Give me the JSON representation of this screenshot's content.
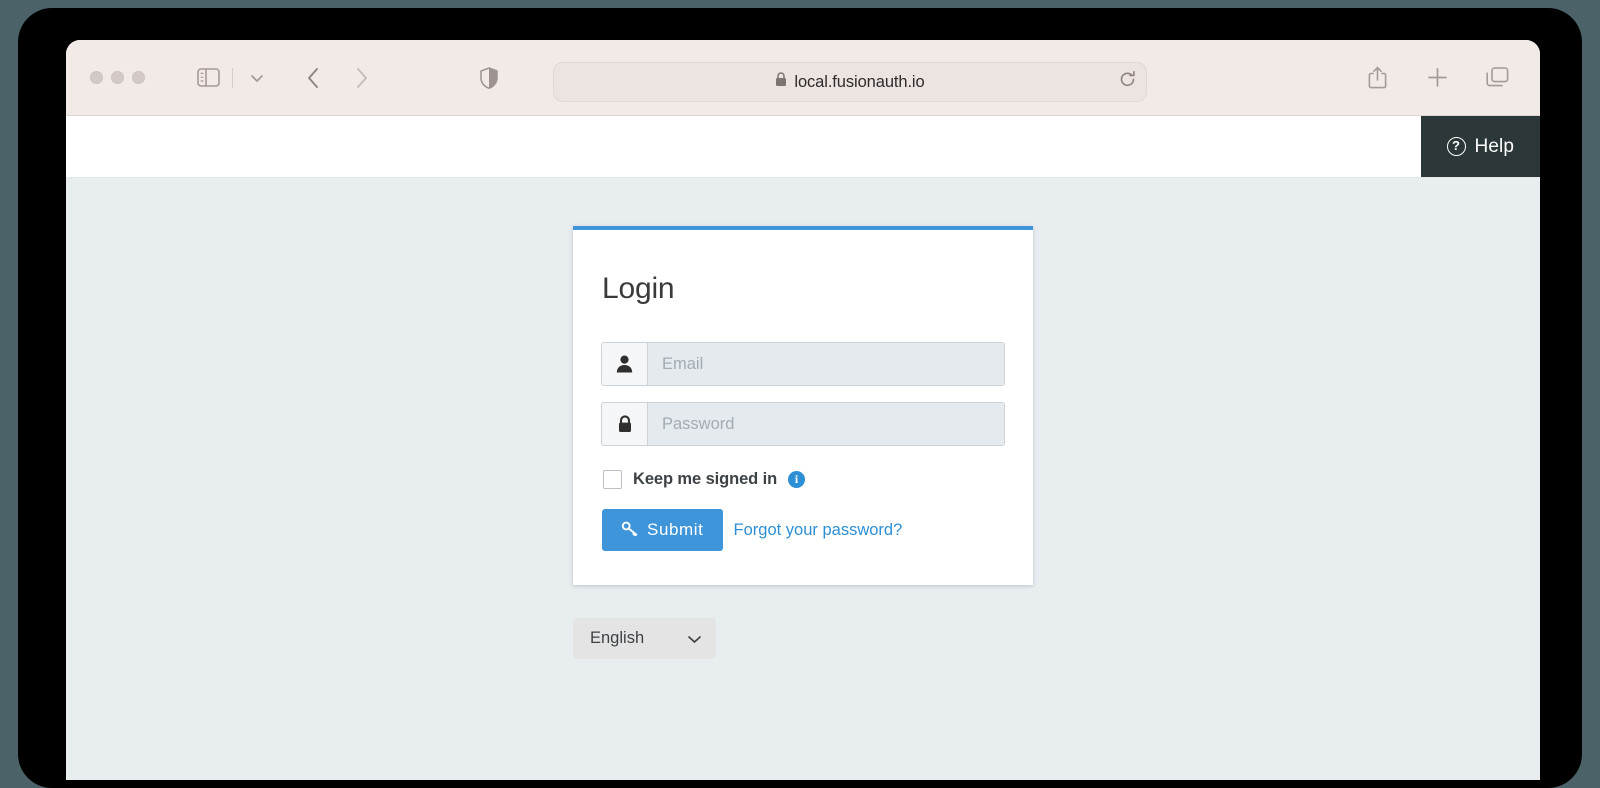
{
  "browser": {
    "traffic_lights": [
      "close",
      "minimize",
      "zoom"
    ],
    "sidebar_toggle_icon": "sidebar-icon",
    "sidebar_dropdown_icon": "chevron-down-icon",
    "back_icon": "chevron-left-icon",
    "forward_icon": "chevron-right-icon",
    "shield_icon": "shield-icon",
    "address": {
      "lock_icon": "lock-icon",
      "url": "local.fusionauth.io",
      "reload_icon": "reload-icon"
    },
    "share_icon": "share-icon",
    "new_tab_icon": "plus-icon",
    "tab_overview_icon": "tab-overview-icon"
  },
  "header": {
    "help_label": "Help",
    "help_icon": "question-circle-icon",
    "help_bg": "#2b3739"
  },
  "login": {
    "title": "Login",
    "accent_color": "#3e95d9",
    "email": {
      "icon": "user-icon",
      "placeholder": "Email",
      "value": ""
    },
    "password": {
      "icon": "lock-icon",
      "placeholder": "Password",
      "value": ""
    },
    "keep_signed_in": {
      "label": "Keep me signed in",
      "checked": false,
      "info_icon": "info-icon",
      "info_color": "#2d8fd5"
    },
    "submit": {
      "label": "Submit",
      "icon": "key-icon"
    },
    "forgot_link": "Forgot your password?"
  },
  "language": {
    "selected": "English",
    "chevron_icon": "chevron-down-icon",
    "options": [
      "English"
    ]
  },
  "page": {
    "background": "#e8edf0"
  }
}
